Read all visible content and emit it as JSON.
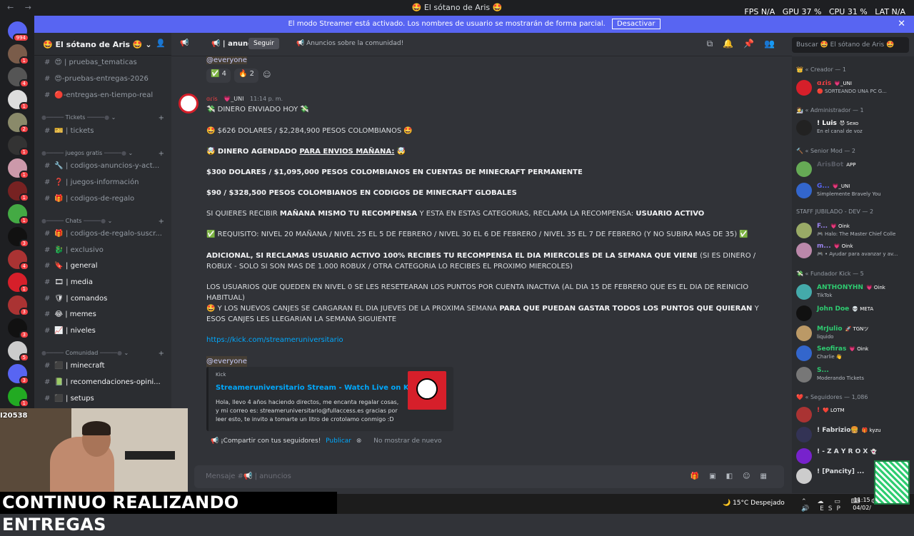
{
  "window": {
    "title": "🤩 El sótano de Aris 🤩",
    "fps": "FPS N/A",
    "gpu": "GPU 37 %",
    "cpu": "CPU 31 %",
    "lat": "LAT N/A"
  },
  "banner": {
    "text": "El modo Streamer está activado. Los nombres de usuario se mostrarán de forma parcial.",
    "button": "Desactivar"
  },
  "server_badges": [
    "994",
    "1",
    "4",
    "1",
    "2",
    "1",
    "1",
    "1",
    "1",
    "3",
    "4",
    "1",
    "3",
    "3",
    "5",
    "3",
    "1",
    "NEVO"
  ],
  "sidebar": {
    "guild": "🤩 El sótano de Aris 🤩",
    "channels": [
      {
        "label": "😍 | pruebas_tematicas"
      },
      {
        "label": "😍-pruebas-entregas-2026"
      },
      {
        "label": "🔴-entregas-en-tiempo-real"
      },
      {
        "label": "🎫 | tickets"
      },
      {
        "label": "🔧 | codigos-anuncios-y-act..."
      },
      {
        "label": "❓ | juegos-información"
      },
      {
        "label": "🎁 | codigos-de-regalo"
      },
      {
        "label": "🎁 | codigos-de-regalo-suscr..."
      },
      {
        "label": "🐉 | exclusivo"
      },
      {
        "label": "🔖 | general"
      },
      {
        "label": "🎞 | media"
      },
      {
        "label": "🛡 | comandos"
      },
      {
        "label": "😂 | memes"
      },
      {
        "label": "📈 | niveles"
      },
      {
        "label": "⬛ | minecraft"
      },
      {
        "label": "📗 | recomendaciones-opini..."
      },
      {
        "label": "⬛ | setups"
      }
    ],
    "categories": [
      "Tickets",
      "juegos gratis",
      "Chats",
      "Comunidad"
    ]
  },
  "topbar": {
    "channel": "📢 | anuncios",
    "follow": "Seguir",
    "topic": "📢 Anuncios sobre la comunidad!",
    "search_placeholder": "Buscar 🤩 El sótano de Aris 🤩"
  },
  "messages": {
    "mention1": "@everyone",
    "reactions": [
      "✅ 4",
      "🔥 2"
    ],
    "author": "ɑɾis",
    "role_tag": "💗_UNI",
    "time": "11:14 p. m.",
    "l1": "💸 DINERO ENVIADO HOY 💸",
    "l2": "🤩 $626 DOLARES / $2,284,900 PESOS COLOMBIANOS 🤩",
    "l3a": "🤯 DINERO AGENDADO ",
    "l3b": "PARA ENVIOS MAÑANA:",
    "l3c": " 🤯",
    "l4": "$300 DOLARES / $1,095,000 PESOS COLOMBIANOS EN CUENTAS DE MINECRAFT PERMANENTE",
    "l5": "$90 / $328,500 PESOS COLOMBIANOS EN CODIGOS DE MINECRAFT GLOBALES",
    "l6a": "SI QUIERES RECIBIR ",
    "l6b": "MAÑANA MISMO TU RECOMPENSA",
    "l6c": " Y ESTA EN ESTAS CATEGORIAS, RECLAMA LA RECOMPENSA: ",
    "l6d": "USUARIO ACTIVO",
    "l7": "✅ REQUISITO: NIVEL 20 MAÑANA / NIVEL 25 EL 5 DE FEBRERO / NIVEL 30 EL 6 DE FEBRERO / NIVEL 35 EL 7 DE FEBRERO (Y NO SUBIRA MAS DE 35) ✅",
    "l8a": "ADICIONAL, SI RECLAMAS USUARIO ACTIVO 100% RECIBES TU RECOMPENSA EL DIA MIERCOLES DE LA SEMANA QUE VIENE",
    "l8b": " (SI ES DINERO / ROBUX - SOLO SI SON MAS DE 1.000 ROBUX / OTRA CATEGORIA LO RECIBES EL PROXIMO MIERCOLES)",
    "l9": "LOS USUARIOS QUE QUEDEN EN NIVEL 0 SE LES RESETEARAN LOS PUNTOS POR CUENTA INACTIVA (AL DIA 15 DE FEBRERO QUE ES EL DIA DE REINICIO HABITUAL)",
    "l10a": "🤩 Y LOS NUEVOS CANJES SE CARGARAN EL DIA JUEVES DE LA PROXIMA SEMANA ",
    "l10b": "PARA QUE PUEDAN GASTAR TODOS LOS PUNTOS QUE QUIERAN",
    "l10c": " Y ESOS CANJES LES LLEGARIAN LA SEMANA SIGUIENTE",
    "link": "https://kick.com/streameruniversitario",
    "mention2": "@everyone",
    "embed": {
      "provider": "Kick",
      "title": "Streameruniversitario Stream - Watch Live on Kick",
      "desc": "Hola, llevo 4 años haciendo directos, me encanta regalar cosas, y mi correo es: streameruniversitario@fullaccess.es gracias por leer esto, te invito a tomarte un litro de crotolamo conmigo :D"
    },
    "share": "📢 ¡Compartir con tus seguidores!",
    "publish": "Publicar",
    "dont_show": "No mostrar de nuevo"
  },
  "composer": {
    "placeholder": "Mensaje #📢 | anuncios"
  },
  "members": {
    "sections": [
      "👑 « Creador — 1",
      "👩‍🔬 « Administrador — 1",
      "🔨 « Senior Mod — 2",
      "STAFF JUBILADO - DEV — 2",
      "💸 « Fundador Kick — 5",
      "❤️ « Seguidores — 1,086"
    ],
    "list": [
      {
        "name": "ɑɾis",
        "tag": "💗_UNI",
        "status": "🔴 SORTEANDO UNA PC G..."
      },
      {
        "name": "! Luis",
        "tag": "😈 Sexo",
        "status": "En el canal de voz"
      },
      {
        "name": "ArisBot",
        "tag": "APP",
        "status": ""
      },
      {
        "name": "G...",
        "tag": "💗_UNI",
        "status": "Simplemente Bravely You"
      },
      {
        "name": "F...",
        "tag": "💗 Oink",
        "status": "🎮 Halo: The Master Chief Colle"
      },
      {
        "name": "m...",
        "tag": "💗 Oink",
        "status": "🎮 • Ayudar para avanzar y av..."
      },
      {
        "name": "ANTHONYHN",
        "tag": "💗 Oink",
        "status": "TikTok"
      },
      {
        "name": "John Doe",
        "tag": "💀 META",
        "status": ""
      },
      {
        "name": "MrJulio",
        "tag": "🚀 TGNツ",
        "status": "liquido"
      },
      {
        "name": "Seofiras",
        "tag": "💗 Oink",
        "status": "Charlie 👋"
      },
      {
        "name": "S...",
        "tag": "",
        "status": "Moderando Tickets"
      },
      {
        "name": "!",
        "tag": "❤️ LOTM",
        "status": ""
      },
      {
        "name": "! Fabrizio🍔",
        "tag": "🎁 kyzu",
        "status": ""
      },
      {
        "name": "! - Z A Y R O X",
        "tag": "👻",
        "status": ""
      },
      {
        "name": "! [Pancity] ...",
        "tag": "",
        "status": ""
      }
    ]
  },
  "stream": {
    "caption": "CONTINUO REALIZANDO ENTREGAS",
    "tag": "I20538"
  },
  "taskbar": {
    "weather": "🌙 15°C Despejado",
    "lang": "ESP",
    "time": "11:15",
    "date": "04/02/"
  }
}
